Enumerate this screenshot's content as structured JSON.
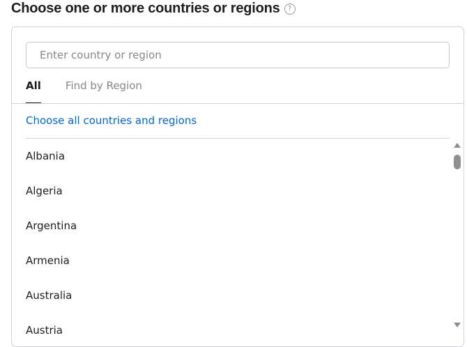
{
  "header": {
    "title": "Choose one or more countries or regions",
    "help_icon": "?"
  },
  "search": {
    "placeholder": "Enter country or region",
    "value": ""
  },
  "tabs": [
    {
      "label": "All",
      "active": true
    },
    {
      "label": "Find by Region",
      "active": false
    }
  ],
  "choose_all_label": "Choose all countries and regions",
  "countries": [
    "Albania",
    "Algeria",
    "Argentina",
    "Armenia",
    "Australia",
    "Austria"
  ],
  "icons": {
    "help": "question-circle-icon",
    "scroll_up": "triangle-up-icon",
    "scroll_down": "triangle-down-icon"
  },
  "colors": {
    "link": "#0066cc",
    "text": "#1d1d1f",
    "muted": "#86868b",
    "border": "#d2d2d7"
  }
}
